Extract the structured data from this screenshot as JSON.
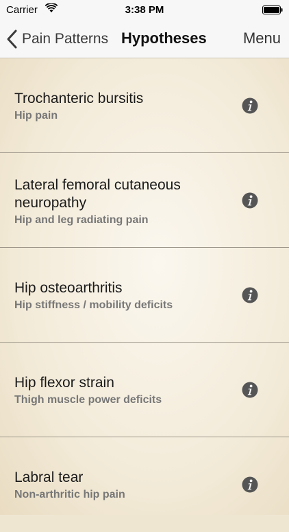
{
  "status": {
    "carrier": "Carrier",
    "time": "3:38 PM"
  },
  "nav": {
    "back_label": "Pain Patterns",
    "title": "Hypotheses",
    "menu_label": "Menu"
  },
  "items": [
    {
      "title": "Trochanteric bursitis",
      "subtitle": "Hip pain"
    },
    {
      "title": "Lateral femoral cutaneous neuropathy",
      "subtitle": "Hip and leg radiating pain"
    },
    {
      "title": "Hip osteoarthritis",
      "subtitle": "Hip stiffness / mobility deficits"
    },
    {
      "title": "Hip flexor strain",
      "subtitle": "Thigh muscle power deficits"
    },
    {
      "title": "Labral tear",
      "subtitle": "Non-arthritic hip pain"
    }
  ],
  "icons": {
    "back": "chevron-left-icon",
    "info": "info-icon",
    "wifi": "wifi-icon",
    "battery": "battery-icon"
  },
  "colors": {
    "background": "#efe6d2",
    "bar": "#f7f7f7",
    "subtitle": "#777777",
    "info_icon": "#555555"
  }
}
